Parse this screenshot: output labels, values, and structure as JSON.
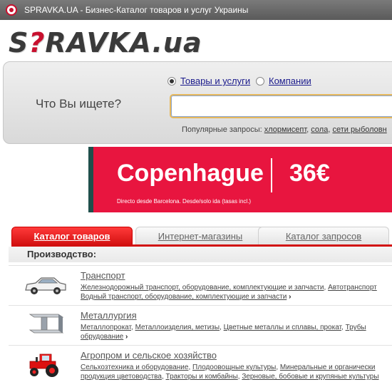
{
  "window": {
    "title": "SPRAVKA.UA - Бизнес-Каталог товаров и услуг Украины"
  },
  "logo": {
    "prefix": "S",
    "accent": "?",
    "rest": "RAVKA.ua"
  },
  "search": {
    "question": "Что Вы ищете?",
    "radio_goods": "Товары и услуги",
    "radio_companies": "Компании",
    "value": "",
    "placeholder": "",
    "popular_label": "Популярные запросы:",
    "popular_items": [
      "хлормисепт",
      "сола",
      "сети рыболовн"
    ]
  },
  "banner": {
    "city": "Copenhague",
    "price": "36€",
    "subtext": "Directo desde Barcelona. Desde/solo ida (tasas incl.)",
    "accent_color": "#e8153f"
  },
  "tabs": [
    {
      "label": "Каталог товаров",
      "active": true
    },
    {
      "label": "Интернет-магазины",
      "active": false
    },
    {
      "label": "Каталог запросов",
      "active": false
    }
  ],
  "section": {
    "title": "Производство:"
  },
  "categories": [
    {
      "name": "Транспорт",
      "icon": "car-icon",
      "links": [
        "Железнодорожный транспорт, оборудование, комплектующие и запчасти",
        "Автотранспорт",
        "Водный транспорт, оборудование, комплектующие и запчасти"
      ]
    },
    {
      "name": "Металлургия",
      "icon": "steel-beam-icon",
      "links": [
        "Металлопрокат",
        "Металлоизделия, метизы",
        "Цветные металлы и сплавы, прокат",
        "Трубы",
        "обрудование"
      ]
    },
    {
      "name": "Агропром и сельское хозяйство",
      "icon": "tractor-icon",
      "links": [
        "Сельхозтехника и оборудование",
        "Плодоовощные культуры",
        "Минеральные и органически",
        "продукция цветоводства",
        "Тракторы и комбайны",
        "Зерновые, бобовые и крупяные культуры"
      ]
    }
  ]
}
